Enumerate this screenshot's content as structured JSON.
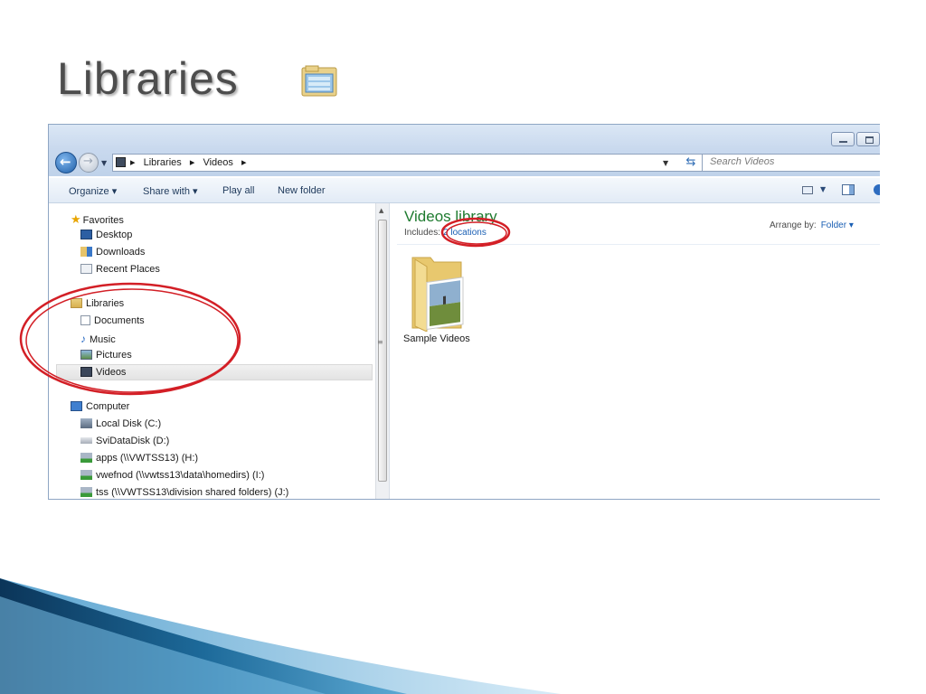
{
  "slide": {
    "title": "Libraries",
    "title_icon": "library-folder-icon"
  },
  "window": {
    "caption_buttons": [
      "minimize",
      "maximize"
    ],
    "breadcrumbs": [
      "Libraries",
      "Videos"
    ],
    "search_placeholder": "Search Videos",
    "toolbar": {
      "organize": "Organize ▾",
      "share_with": "Share with ▾",
      "play_all": "Play all",
      "new_folder": "New folder"
    },
    "nav": {
      "favorites": {
        "label": "Favorites",
        "items": [
          "Desktop",
          "Downloads",
          "Recent Places"
        ]
      },
      "libraries": {
        "label": "Libraries",
        "items": [
          "Documents",
          "Music",
          "Pictures",
          "Videos"
        ],
        "selected": "Videos"
      },
      "computer": {
        "label": "Computer",
        "items": [
          "Local Disk (C:)",
          "SviDataDisk (D:)",
          "apps (\\\\VWTSS13) (H:)",
          "vwefnod (\\\\vwtss13\\data\\homedirs) (I:)",
          "tss (\\\\VWTSS13\\division shared folders) (J:)"
        ]
      }
    },
    "content": {
      "library_title": "Videos library",
      "includes_label": "Includes:",
      "locations_link": "2 locations",
      "arrange_by_label": "Arrange by:",
      "arrange_by_value": "Folder ▾",
      "items": [
        {
          "name": "Sample Videos",
          "icon": "video-folder-icon"
        }
      ]
    }
  },
  "annotations": {
    "highlight_color": "#d31f26"
  },
  "colors": {
    "library_title": "#1e7b2f",
    "link": "#1a5fb4",
    "swoosh_dark": "#0b3559",
    "swoosh_light": "#bcdcf0"
  }
}
